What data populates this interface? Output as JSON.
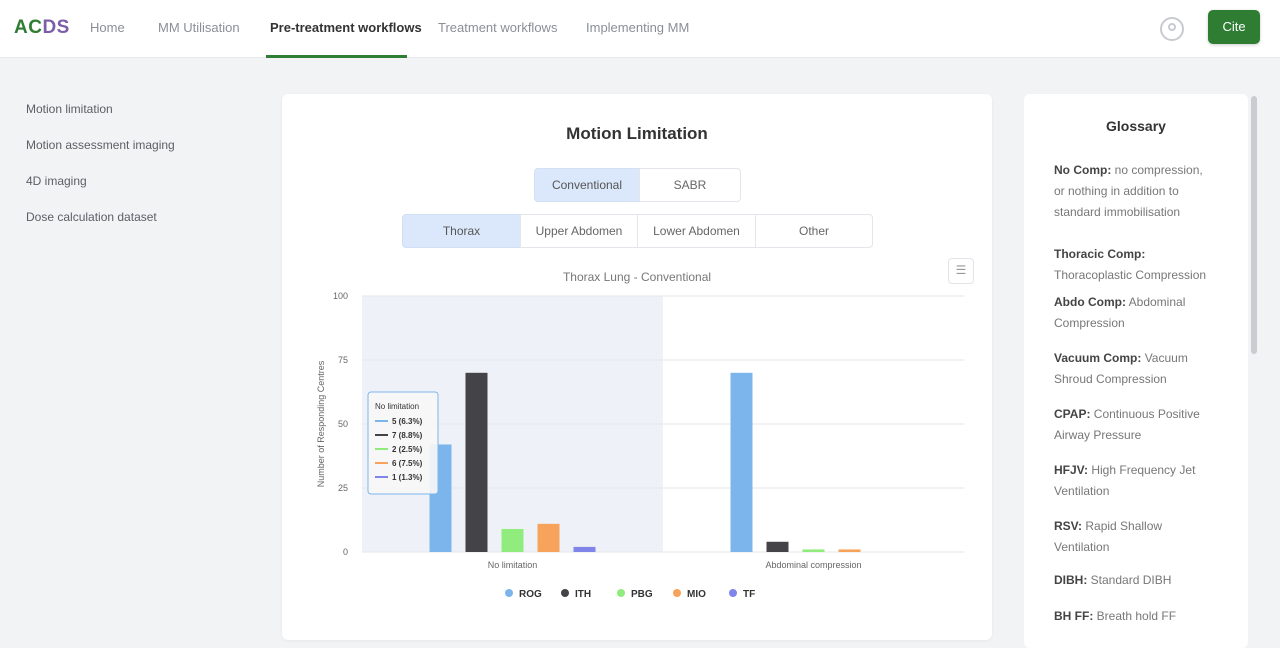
{
  "header": {
    "logo_part1": "AC",
    "logo_part2": "DS",
    "nav": [
      "Home",
      "MM Utilisation",
      "Pre-treatment workflows",
      "Treatment workflows",
      "Implementing MM"
    ],
    "active_nav": "Pre-treatment workflows",
    "cite_label": "Cite"
  },
  "sidebar": {
    "items": [
      "Motion limitation",
      "Motion assessment imaging",
      "4D imaging",
      "Dose calculation dataset"
    ]
  },
  "main": {
    "title": "Motion Limitation",
    "mode_tabs": [
      "Conventional",
      "SABR"
    ],
    "mode_selected": "Conventional",
    "site_tabs": [
      "Thorax",
      "Upper Abdomen",
      "Lower Abdomen",
      "Other"
    ],
    "site_selected": "Thorax",
    "chart_title": "Thorax Lung - Conventional",
    "menu_icon": "hamburger-icon",
    "tooltip_title": "No limitation",
    "tooltip_rows": [
      "5 (6.3%)",
      "7 (8.8%)",
      "2 (2.5%)",
      "6 (7.5%)",
      "1 (1.3%)"
    ]
  },
  "chart_data": {
    "type": "bar",
    "title": "Thorax Lung - Conventional",
    "xlabel": "",
    "ylabel": "Number of Responding Centres",
    "ylim": [
      0,
      100
    ],
    "yticks": [
      "0",
      "25",
      "50",
      "75",
      "100"
    ],
    "categories": [
      "No limitation",
      "Abdominal compression"
    ],
    "highlight_category": "No limitation",
    "legend_position": "bottom",
    "series": [
      {
        "name": "ROG",
        "color": "#7cb5ec",
        "values": [
          42,
          70
        ]
      },
      {
        "name": "ITH",
        "color": "#434348",
        "values": [
          70,
          4
        ]
      },
      {
        "name": "PBG",
        "color": "#90ed7d",
        "values": [
          9,
          1
        ]
      },
      {
        "name": "MIO",
        "color": "#f7a35c",
        "values": [
          11,
          1
        ]
      },
      {
        "name": "TF",
        "color": "#8085e9",
        "values": [
          2,
          0
        ]
      }
    ]
  },
  "glossary": {
    "title": "Glossary",
    "entries": [
      {
        "term": "No Comp:",
        "desc": "no compression, or nothing in addition to standard immobilisation"
      },
      {
        "term": "Thoracic Comp:",
        "desc": "Thoracoplastic Compression"
      },
      {
        "term": "Abdo Comp:",
        "desc": "Abdominal Compression"
      },
      {
        "term": "Vacuum Comp:",
        "desc": "Vacuum Shroud Compression"
      },
      {
        "term": "CPAP:",
        "desc": "Continuous Positive Airway Pressure"
      },
      {
        "term": "HFJV:",
        "desc": "High Frequency Jet Ventilation"
      },
      {
        "term": "RSV:",
        "desc": "Rapid Shallow Ventilation"
      },
      {
        "term": "DIBH:",
        "desc": "Standard DIBH"
      },
      {
        "term": "BH FF:",
        "desc": "Breath hold FF"
      }
    ]
  }
}
